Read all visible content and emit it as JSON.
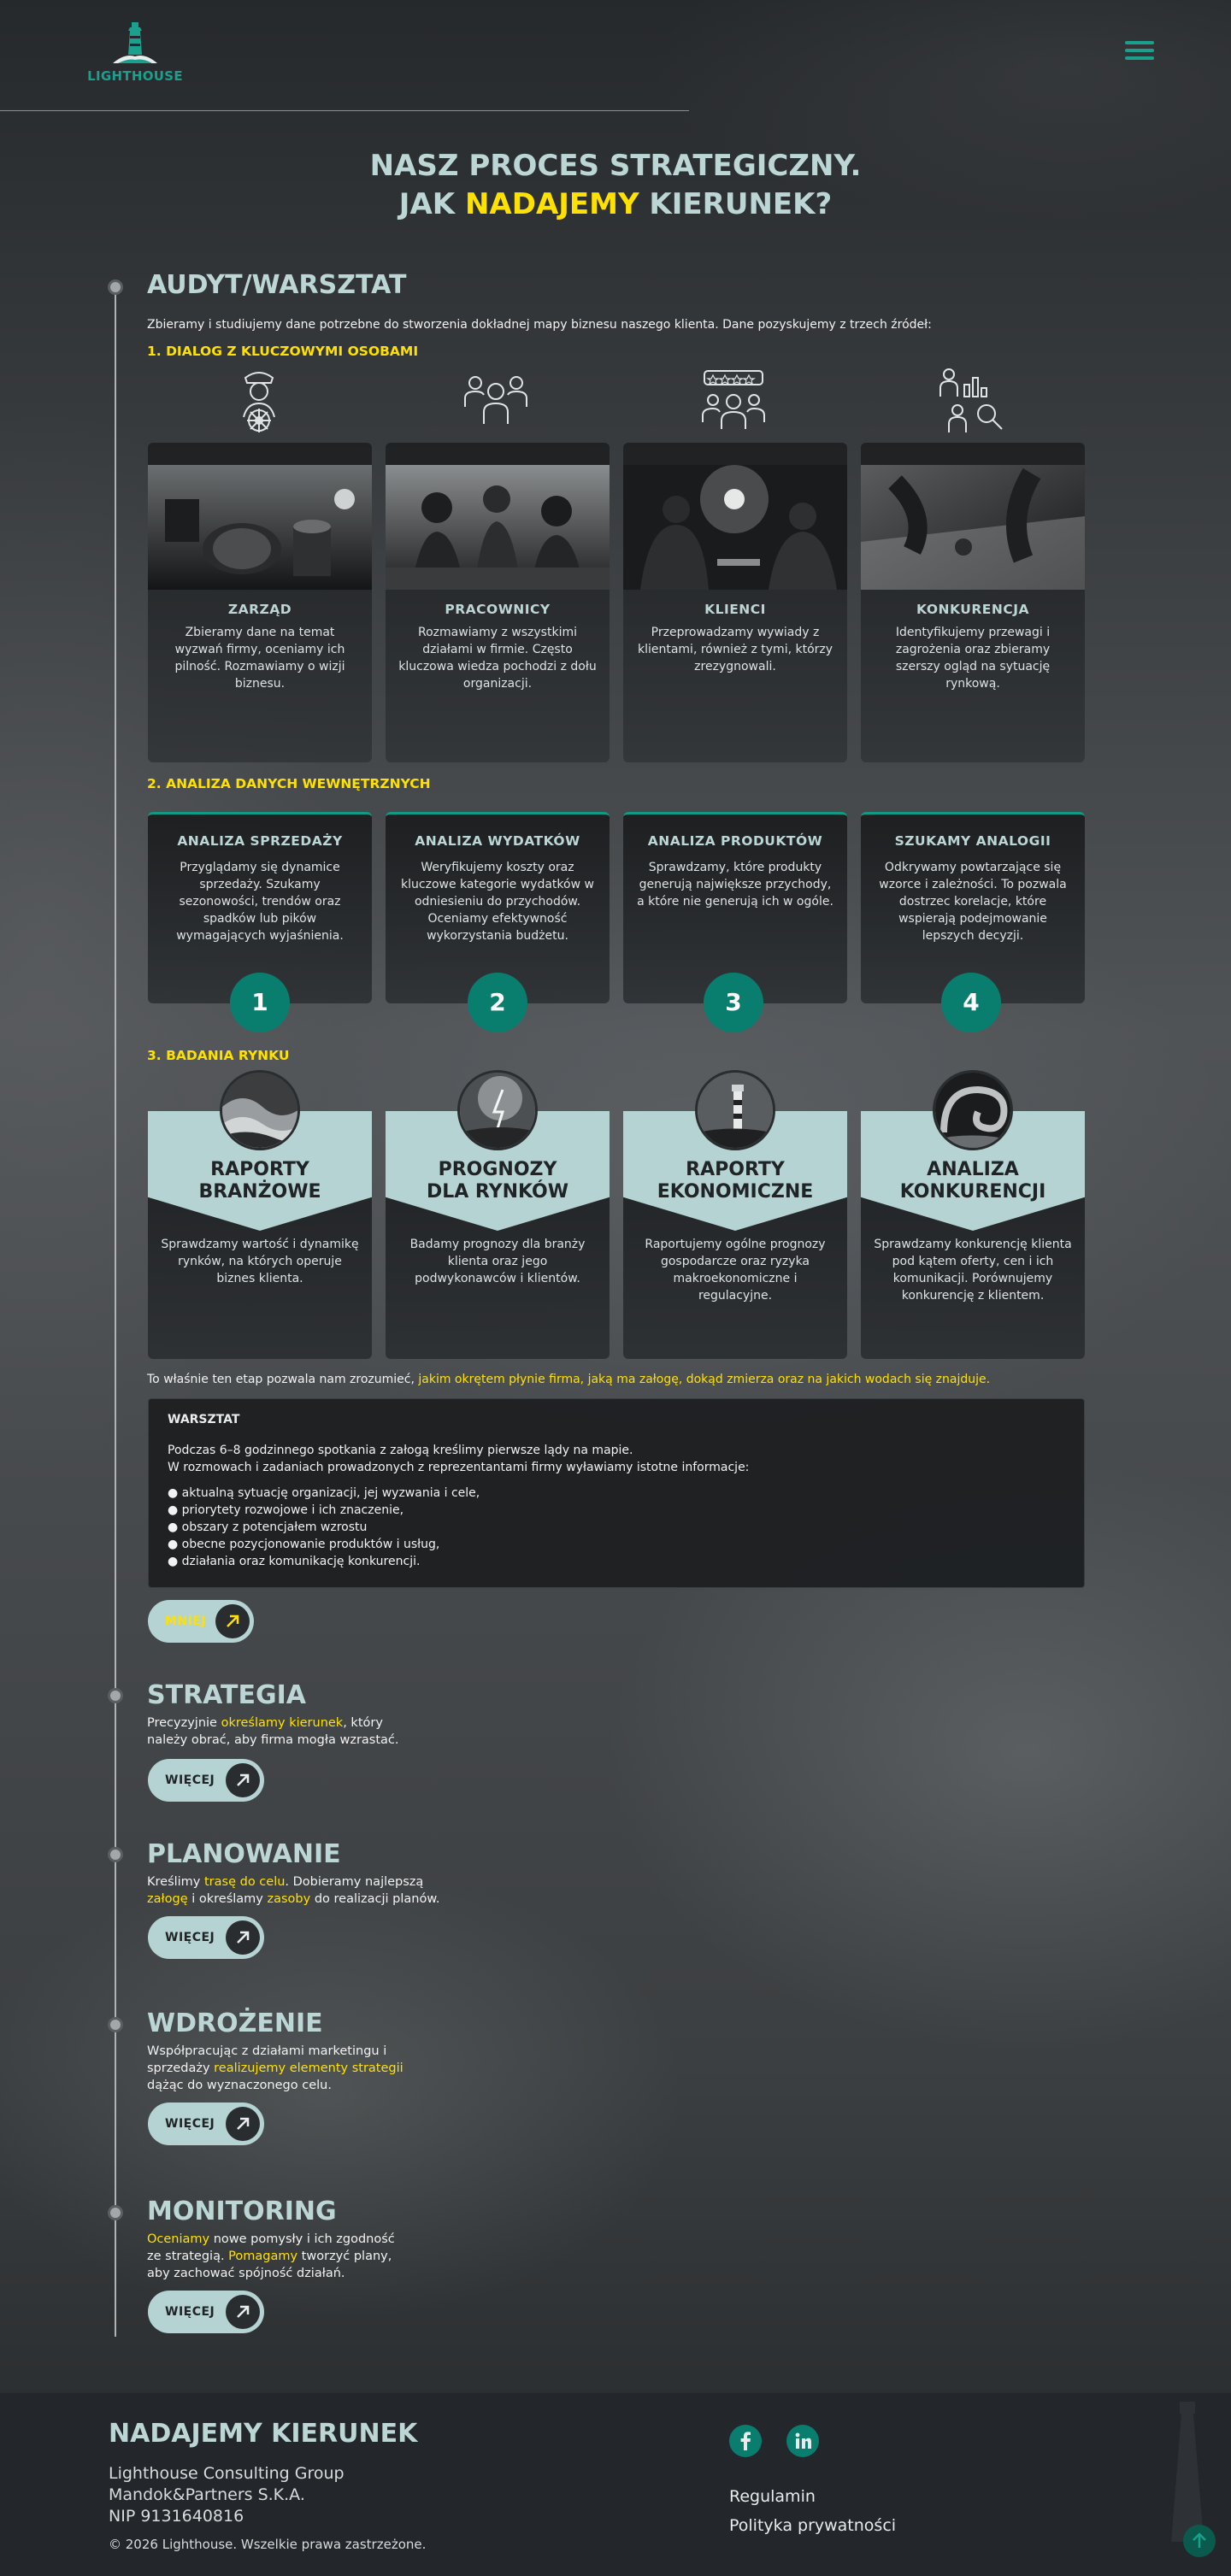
{
  "header": {
    "logo_text": "LIGHTHOUSE",
    "menu_icon": "hamburger-menu-icon"
  },
  "hero": {
    "line1": "NASZ PROCES STRATEGICZNY.",
    "line2_pre": "JAK ",
    "line2_hl": "NADAJEMY",
    "line2_post": " KIERUNEK?"
  },
  "audit": {
    "title": "AUDYT/WARSZTAT",
    "intro": "Zbieramy i studiujemy dane potrzebne do stworzenia dokładnej mapy biznesu naszego klienta. Dane pozyskujemy z trzech źródeł:",
    "dialog_heading": "1. DIALOG Z KLUCZOWYMI OSOBAMI",
    "people": [
      {
        "icon": "captain-helm-icon",
        "title": "ZARZĄD",
        "text": "Zbieramy dane na temat wyzwań firmy, oceniamy ich pilność. Rozmawiamy o wizji biznesu."
      },
      {
        "icon": "team-people-icon",
        "title": "PRACOWNICY",
        "text": "Rozmawiamy z wszystkimi działami w firmie. Często kluczowa wiedza pochodzi z dołu organizacji."
      },
      {
        "icon": "customer-rating-icon",
        "title": "KLIENCI",
        "text": "Przeprowadzamy wywiady z klientami, również z tymi, którzy zrezygnowali."
      },
      {
        "icon": "competition-analysis-icon",
        "title": "KONKURENCJA",
        "text": "Identyfikujemy przewagi i zagrożenia oraz zbieramy szerszy ogląd na sytuację rynkową."
      }
    ],
    "internal_heading": "2. ANALIZA DANYCH WEWNĘTRZNYCH",
    "analyses": [
      {
        "title": "ANALIZA SPRZEDAŻY",
        "text": "Przyglądamy się dynamice sprzedaży. Szukamy sezonowości, trendów oraz spadków lub pików wymagających wyjaśnienia.",
        "num": "1"
      },
      {
        "title": "ANALIZA WYDATKÓW",
        "text": "Weryfikujemy koszty oraz kluczowe kategorie wydatków w odniesieniu do przychodów. Oceniamy efektywność wykorzystania budżetu.",
        "num": "2"
      },
      {
        "title": "ANALIZA PRODUKTÓW",
        "text": "Sprawdzamy, które produkty generują największe przychody, a które nie generują ich w ogóle.",
        "num": "3"
      },
      {
        "title": "SZUKAMY ANALOGII",
        "text": "Odkrywamy powtarzające się wzorce i zależności. To pozwala dostrzec korelacje, które wspierają podejmowanie lepszych decyzji.",
        "num": "4"
      }
    ],
    "market_heading": "3. BADANIA RYNKU",
    "reports": [
      {
        "title1": "RAPORTY",
        "title2": "BRANŻOWE",
        "text": "Sprawdzamy wartość i dynamikę rynków, na których operuje biznes klienta."
      },
      {
        "title1": "PROGNOZY",
        "title2": "DLA RYNKÓW",
        "text": "Badamy prognozy dla branży klienta oraz jego podwykonawców i klientów."
      },
      {
        "title1": "RAPORTY",
        "title2": "EKONOMICZNE",
        "text": "Raportujemy ogólne prognozy gospodarcze oraz ryzyka makroekonomiczne i regulacyjne."
      },
      {
        "title1": "ANALIZA",
        "title2": "KONKURENCJI",
        "text": "Sprawdzamy konkurencję klienta pod kątem oferty, cen i ich komunikacji. Porównujemy konkurencję z klientem."
      }
    ],
    "summary_pre": "To właśnie ten etap pozwala nam zrozumieć, ",
    "summary_hl": "jakim okrętem płynie firma, jaką ma załogę, dokąd zmierza oraz na jakich wodach się znajduje.",
    "workshop": {
      "title": "WARSZTAT",
      "line1": "Podczas 6–8 godzinnego spotkania z załogą kreślimy pierwsze lądy na mapie.",
      "line2": "W rozmowach i zadaniach prowadzonych z reprezentantami firmy wyławiamy istotne informacje:",
      "bullets": [
        "aktualną sytuację organizacji, jej wyzwania i cele,",
        "priorytety rozwojowe i ich znaczenie,",
        "obszary z potencjałem wzrostu",
        "obecne pozycjonowanie produktów i usług,",
        "działania oraz komunikację konkurencji."
      ]
    },
    "less_btn": "MNIEJ"
  },
  "stages": [
    {
      "title": "STRATEGIA",
      "t1": "Precyzyjnie ",
      "h1": "określamy kierunek",
      "t2": ", który",
      "t3": "należy obrać, aby firma mogła wzrastać.",
      "h2": "",
      "t4": "",
      "h3": "",
      "t5": "",
      "btn": "WIĘCEJ"
    },
    {
      "title": "PLANOWANIE",
      "t1": "Kreślimy ",
      "h1": "trasę do celu",
      "t2": ". Dobieramy najlepszą",
      "t3": "",
      "h2": "załogę",
      "t4": " i określamy ",
      "h3": "zasoby",
      "t5": " do realizacji planów.",
      "btn": "WIĘCEJ"
    },
    {
      "title": "WDROŻENIE",
      "t1": "Współpracując z działami marketingu i",
      "h1": "",
      "t2": "",
      "t3": "sprzedaży ",
      "h2": "realizujemy elementy strategii",
      "t4": "",
      "h3": "",
      "t5": "dążąc do wyznaczonego celu.",
      "btn": "WIĘCEJ"
    },
    {
      "title": "MONITORING",
      "t1": "",
      "h1": "Oceniamy",
      "t2": " nowe pomysły i ich zgodność",
      "t3": "ze strategią. ",
      "h2": "Pomagamy",
      "t4": " tworzyć plany,",
      "h3": "",
      "t5": "aby zachować spójność działań.",
      "btn": "WIĘCEJ"
    }
  ],
  "footer": {
    "heading": "NADAJEMY KIERUNEK",
    "company1": "Lighthouse Consulting Group",
    "company2": "Mandok&Partners S.K.A.",
    "nip": "NIP 9131640816",
    "copyright": "© 2026 Lighthouse. Wszelkie prawa zastrzeżone.",
    "links": [
      "Regulamin",
      "Polityka prywatności"
    ],
    "social": [
      "facebook-icon",
      "linkedin-icon"
    ]
  },
  "colors": {
    "accent": "#ffe100",
    "teal": "#0a7e6e",
    "light_teal": "#b5d3d3",
    "heading": "#bcd6d6"
  }
}
